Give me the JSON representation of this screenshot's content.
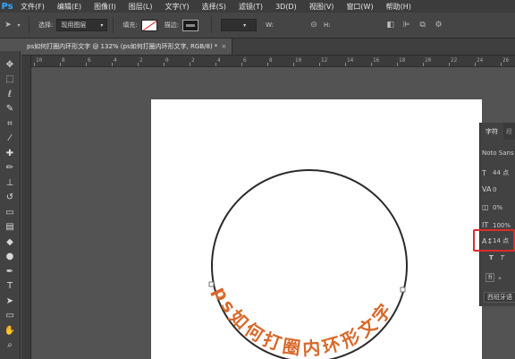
{
  "app": {
    "logo_text": "Ps"
  },
  "menu": {
    "items": [
      {
        "label": "文件(F)"
      },
      {
        "label": "编辑(E)"
      },
      {
        "label": "图像(I)"
      },
      {
        "label": "图层(L)"
      },
      {
        "label": "文字(Y)"
      },
      {
        "label": "选择(S)"
      },
      {
        "label": "滤镜(T)"
      },
      {
        "label": "3D(D)"
      },
      {
        "label": "视图(V)"
      },
      {
        "label": "窗口(W)"
      },
      {
        "label": "帮助(H)"
      }
    ]
  },
  "options": {
    "select_label": "选择:",
    "select_value": "现用图层",
    "fill_label": "填充:",
    "stroke_label": "描边:",
    "w_label": "W:",
    "h_label": "H:"
  },
  "document": {
    "tab_title": "ps如何打圈内环形文字 @ 132% (ps如何打圈内环形文字, RGB/8) *",
    "close_glyph": "×",
    "path_text": "ps如何打圈内环形文字",
    "path_text_color": "#d8692b",
    "circle_color": "#2a2a2a"
  },
  "ruler": {
    "top_ticks": [
      "10",
      "8",
      "6",
      "4",
      "2",
      "0",
      "2",
      "4",
      "6",
      "8",
      "10",
      "12",
      "14",
      "16",
      "18",
      "20",
      "22",
      "24",
      "26"
    ]
  },
  "character_panel": {
    "tab_label": "字符",
    "tab2_label": "段",
    "font_family": "Noto Sans",
    "font_size": "44 点",
    "kerning": "0",
    "scale": "0%",
    "vertical_scale": "100%",
    "baseline_shift": "14 点",
    "bottom_button": "西班牙语"
  },
  "colors": {
    "highlight": "#e12a2a",
    "accent": "#31a8ff"
  }
}
